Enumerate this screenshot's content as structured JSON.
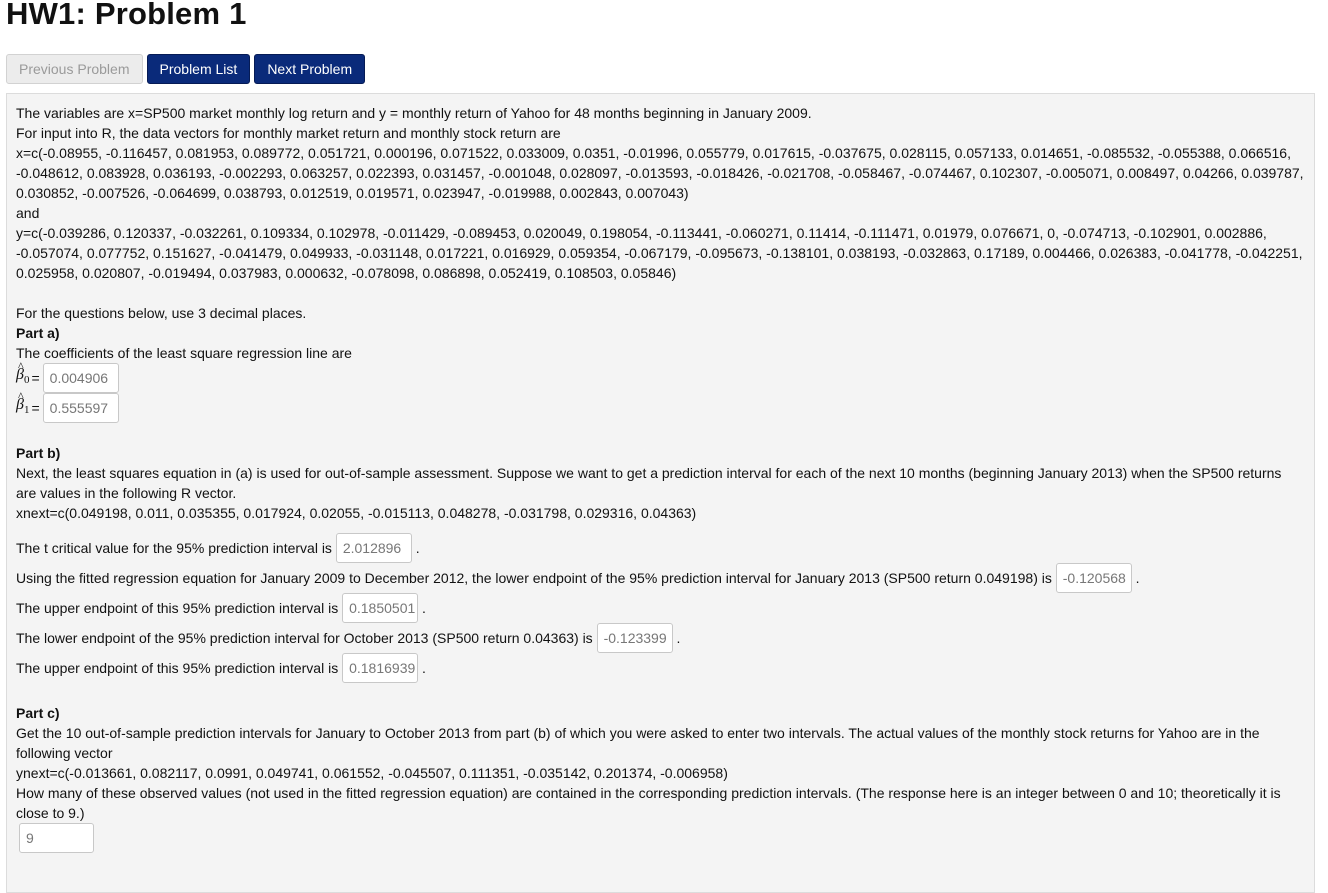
{
  "page": {
    "title": "HW1: Problem 1"
  },
  "nav": {
    "previous": "Previous Problem",
    "list": "Problem List",
    "next": "Next Problem"
  },
  "problem": {
    "intro1": "The variables are x=SP500 market monthly log return and y = monthly return of Yahoo for 48 months beginning in January 2009.",
    "intro2": "For input into R, the data vectors for monthly market return and monthly stock return are",
    "x_vector": "x=c(-0.08955, -0.116457, 0.081953, 0.089772, 0.051721, 0.000196, 0.071522, 0.033009, 0.0351, -0.01996, 0.055779, 0.017615, -0.037675, 0.028115, 0.057133, 0.014651, -0.085532, -0.055388, 0.066516, -0.048612, 0.083928, 0.036193, -0.002293, 0.063257, 0.022393, 0.031457, -0.001048, 0.028097, -0.013593, -0.018426, -0.021708, -0.058467, -0.074467, 0.102307, -0.005071, 0.008497, 0.04266, 0.039787, 0.030852, -0.007526, -0.064699, 0.038793, 0.012519, 0.019571, 0.023947, -0.019988, 0.002843, 0.007043)",
    "and": "and",
    "y_vector": "y=c(-0.039286, 0.120337, -0.032261, 0.109334, 0.102978, -0.011429, -0.089453, 0.020049, 0.198054, -0.113441, -0.060271, 0.11414, -0.111471, 0.01979, 0.076671, 0, -0.074713, -0.102901, 0.002886, -0.057074, 0.077752, 0.151627, -0.041479, 0.049933, -0.031148, 0.017221, 0.016929, 0.059354, -0.067179, -0.095673, -0.138101, 0.038193, -0.032863, 0.17189, 0.004466, 0.026383, -0.041778, -0.042251, 0.025958, 0.020807, -0.019494, 0.037983, 0.000632, -0.078098, 0.086898, 0.052419, 0.108503, 0.05846)",
    "decimals_note": "For the questions below, use 3 decimal places.",
    "part_a": {
      "heading": "Part a)",
      "text": "The coefficients of the least square regression line are",
      "beta0_label": "β",
      "beta0_sub": "0",
      "beta1_label": "β",
      "beta1_sub": "1",
      "equals": "=",
      "beta0_value": "0.004906",
      "beta1_value": "0.555597"
    },
    "part_b": {
      "heading": "Part b)",
      "text": "Next, the least squares equation in (a) is used for out-of-sample assessment. Suppose we want to get a prediction interval for each of the next 10 months (beginning January 2013) when the SP500 returns are values in the following R vector.",
      "xnext": "xnext=c(0.049198, 0.011, 0.035355, 0.017924, 0.02055, -0.015113, 0.048278, -0.031798, 0.029316, 0.04363)",
      "t_label": "The t critical value for the 95% prediction interval is",
      "t_value": "2.012896",
      "lower_jan_label": "Using the fitted regression equation for January 2009 to December 2012, the lower endpoint of the 95% prediction interval for January 2013 (SP500 return 0.049198) is",
      "lower_jan_value": "-0.120568",
      "upper_jan_label": "The upper endpoint of this 95% prediction interval is",
      "upper_jan_value": "0.1850501",
      "lower_oct_label": "The lower endpoint of the 95% prediction interval for October 2013 (SP500 return 0.04363) is",
      "lower_oct_value": "-0.123399",
      "upper_oct_label": "The upper endpoint of this 95% prediction interval is",
      "upper_oct_value": "0.1816939",
      "period": "."
    },
    "part_c": {
      "heading": "Part c)",
      "text": "Get the 10 out-of-sample prediction intervals for January to October 2013 from part (b) of which you were asked to enter two intervals. The actual values of the monthly stock returns for Yahoo are in the following vector",
      "ynext": "ynext=c(-0.013661, 0.082117, 0.0991, 0.049741, 0.061552, -0.045507, 0.111351, -0.035142, 0.201374, -0.006958)",
      "question": "How many of these observed values (not used in the fitted regression equation) are contained in the corresponding prediction intervals. (The response here is an integer between 0 and 10; theoretically it is close to 9.)",
      "answer": "9"
    }
  }
}
